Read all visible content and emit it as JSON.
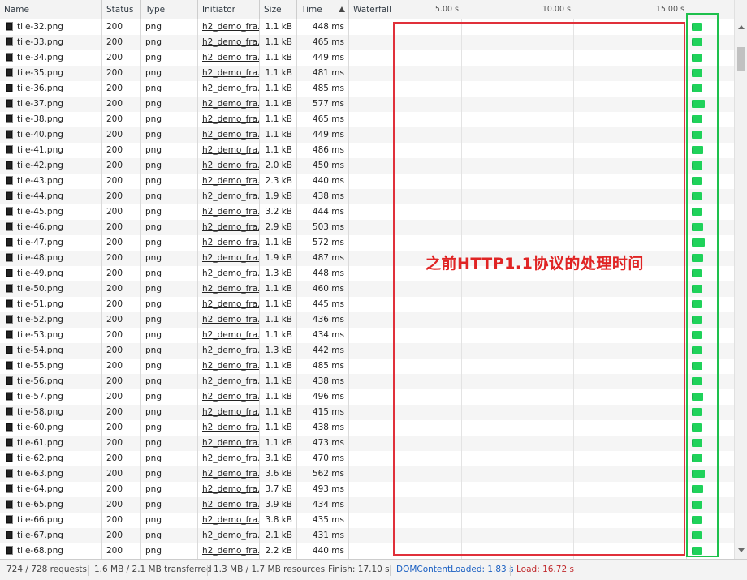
{
  "columns": {
    "name": "Name",
    "status": "Status",
    "type": "Type",
    "initiator": "Initiator",
    "size": "Size",
    "time": "Time",
    "waterfall": "Waterfall"
  },
  "waterfall_ticks": [
    "5.00 s",
    "10.00 s",
    "15.00 s"
  ],
  "rows": [
    {
      "name": "tile-32.png",
      "status": "200",
      "type": "png",
      "initiator": "h2_demo_fra...",
      "size": "1.1 kB",
      "time": "448 ms"
    },
    {
      "name": "tile-33.png",
      "status": "200",
      "type": "png",
      "initiator": "h2_demo_fra...",
      "size": "1.1 kB",
      "time": "465 ms"
    },
    {
      "name": "tile-34.png",
      "status": "200",
      "type": "png",
      "initiator": "h2_demo_fra...",
      "size": "1.1 kB",
      "time": "449 ms"
    },
    {
      "name": "tile-35.png",
      "status": "200",
      "type": "png",
      "initiator": "h2_demo_fra...",
      "size": "1.1 kB",
      "time": "481 ms"
    },
    {
      "name": "tile-36.png",
      "status": "200",
      "type": "png",
      "initiator": "h2_demo_fra...",
      "size": "1.1 kB",
      "time": "485 ms"
    },
    {
      "name": "tile-37.png",
      "status": "200",
      "type": "png",
      "initiator": "h2_demo_fra...",
      "size": "1.1 kB",
      "time": "577 ms"
    },
    {
      "name": "tile-38.png",
      "status": "200",
      "type": "png",
      "initiator": "h2_demo_fra...",
      "size": "1.1 kB",
      "time": "465 ms"
    },
    {
      "name": "tile-40.png",
      "status": "200",
      "type": "png",
      "initiator": "h2_demo_fra...",
      "size": "1.1 kB",
      "time": "449 ms"
    },
    {
      "name": "tile-41.png",
      "status": "200",
      "type": "png",
      "initiator": "h2_demo_fra...",
      "size": "1.1 kB",
      "time": "486 ms"
    },
    {
      "name": "tile-42.png",
      "status": "200",
      "type": "png",
      "initiator": "h2_demo_fra...",
      "size": "2.0 kB",
      "time": "450 ms"
    },
    {
      "name": "tile-43.png",
      "status": "200",
      "type": "png",
      "initiator": "h2_demo_fra...",
      "size": "2.3 kB",
      "time": "440 ms"
    },
    {
      "name": "tile-44.png",
      "status": "200",
      "type": "png",
      "initiator": "h2_demo_fra...",
      "size": "1.9 kB",
      "time": "438 ms"
    },
    {
      "name": "tile-45.png",
      "status": "200",
      "type": "png",
      "initiator": "h2_demo_fra...",
      "size": "3.2 kB",
      "time": "444 ms"
    },
    {
      "name": "tile-46.png",
      "status": "200",
      "type": "png",
      "initiator": "h2_demo_fra...",
      "size": "2.9 kB",
      "time": "503 ms"
    },
    {
      "name": "tile-47.png",
      "status": "200",
      "type": "png",
      "initiator": "h2_demo_fra...",
      "size": "1.1 kB",
      "time": "572 ms"
    },
    {
      "name": "tile-48.png",
      "status": "200",
      "type": "png",
      "initiator": "h2_demo_fra...",
      "size": "1.9 kB",
      "time": "487 ms"
    },
    {
      "name": "tile-49.png",
      "status": "200",
      "type": "png",
      "initiator": "h2_demo_fra...",
      "size": "1.3 kB",
      "time": "448 ms"
    },
    {
      "name": "tile-50.png",
      "status": "200",
      "type": "png",
      "initiator": "h2_demo_fra...",
      "size": "1.1 kB",
      "time": "460 ms"
    },
    {
      "name": "tile-51.png",
      "status": "200",
      "type": "png",
      "initiator": "h2_demo_fra...",
      "size": "1.1 kB",
      "time": "445 ms"
    },
    {
      "name": "tile-52.png",
      "status": "200",
      "type": "png",
      "initiator": "h2_demo_fra...",
      "size": "1.1 kB",
      "time": "436 ms"
    },
    {
      "name": "tile-53.png",
      "status": "200",
      "type": "png",
      "initiator": "h2_demo_fra...",
      "size": "1.1 kB",
      "time": "434 ms"
    },
    {
      "name": "tile-54.png",
      "status": "200",
      "type": "png",
      "initiator": "h2_demo_fra...",
      "size": "1.3 kB",
      "time": "442 ms"
    },
    {
      "name": "tile-55.png",
      "status": "200",
      "type": "png",
      "initiator": "h2_demo_fra...",
      "size": "1.1 kB",
      "time": "485 ms"
    },
    {
      "name": "tile-56.png",
      "status": "200",
      "type": "png",
      "initiator": "h2_demo_fra...",
      "size": "1.1 kB",
      "time": "438 ms"
    },
    {
      "name": "tile-57.png",
      "status": "200",
      "type": "png",
      "initiator": "h2_demo_fra...",
      "size": "1.1 kB",
      "time": "496 ms"
    },
    {
      "name": "tile-58.png",
      "status": "200",
      "type": "png",
      "initiator": "h2_demo_fra...",
      "size": "1.1 kB",
      "time": "415 ms"
    },
    {
      "name": "tile-60.png",
      "status": "200",
      "type": "png",
      "initiator": "h2_demo_fra...",
      "size": "1.1 kB",
      "time": "438 ms"
    },
    {
      "name": "tile-61.png",
      "status": "200",
      "type": "png",
      "initiator": "h2_demo_fra...",
      "size": "1.1 kB",
      "time": "473 ms"
    },
    {
      "name": "tile-62.png",
      "status": "200",
      "type": "png",
      "initiator": "h2_demo_fra...",
      "size": "3.1 kB",
      "time": "470 ms"
    },
    {
      "name": "tile-63.png",
      "status": "200",
      "type": "png",
      "initiator": "h2_demo_fra...",
      "size": "3.6 kB",
      "time": "562 ms"
    },
    {
      "name": "tile-64.png",
      "status": "200",
      "type": "png",
      "initiator": "h2_demo_fra...",
      "size": "3.7 kB",
      "time": "493 ms"
    },
    {
      "name": "tile-65.png",
      "status": "200",
      "type": "png",
      "initiator": "h2_demo_fra...",
      "size": "3.9 kB",
      "time": "434 ms"
    },
    {
      "name": "tile-66.png",
      "status": "200",
      "type": "png",
      "initiator": "h2_demo_fra...",
      "size": "3.8 kB",
      "time": "435 ms"
    },
    {
      "name": "tile-67.png",
      "status": "200",
      "type": "png",
      "initiator": "h2_demo_fra...",
      "size": "2.1 kB",
      "time": "431 ms"
    },
    {
      "name": "tile-68.png",
      "status": "200",
      "type": "png",
      "initiator": "h2_demo_fra...",
      "size": "2.2 kB",
      "time": "440 ms"
    }
  ],
  "annotation": "之前HTTP1.1协议的处理时间",
  "status_bar": {
    "requests": "724 / 728 requests",
    "transferred": "1.6 MB / 2.1 MB transferred",
    "resources": "1.3 MB / 1.7 MB resources",
    "finish": "Finish: 17.10 s",
    "dom_content_loaded": "DOMContentLoaded: 1.83 s",
    "load": "Load: 16.72 s"
  },
  "colors": {
    "bar": "#1fd25a",
    "annotation_box": "#e0303a",
    "highlight_box": "#1ec04c",
    "dom_content_loaded": "#1a5fc2",
    "load": "#c0282b"
  }
}
